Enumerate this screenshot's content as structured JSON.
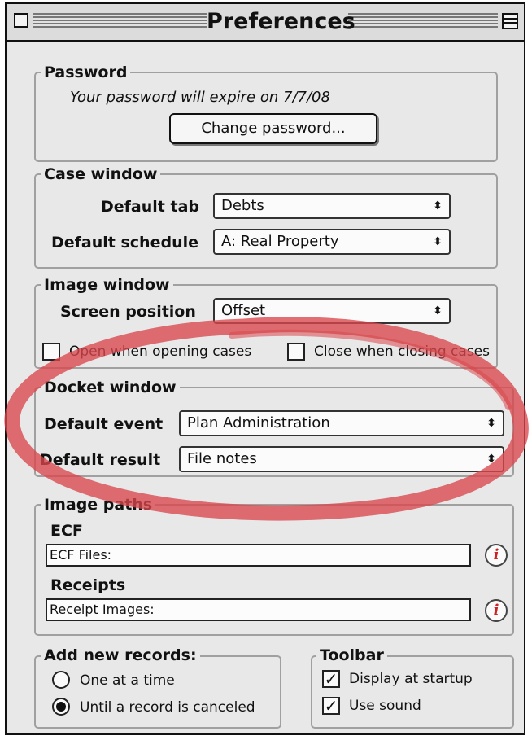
{
  "window": {
    "title": "Preferences"
  },
  "password": {
    "group_title": "Password",
    "expire_text": "Your password will expire on 7/7/08",
    "change_button": "Change password..."
  },
  "case_window": {
    "group_title": "Case window",
    "default_tab_label": "Default tab",
    "default_tab_value": "Debts",
    "default_schedule_label": "Default schedule",
    "default_schedule_value": "A: Real Property"
  },
  "image_window": {
    "group_title": "Image window",
    "screen_position_label": "Screen position",
    "screen_position_value": "Offset",
    "open_when_opening": {
      "label": "Open when opening cases",
      "checked": false
    },
    "close_when_closing": {
      "label": "Close when closing cases",
      "checked": false
    }
  },
  "docket_window": {
    "group_title": "Docket window",
    "default_event_label": "Default event",
    "default_event_value": "Plan Administration",
    "default_result_label": "Default result",
    "default_result_value": "File notes"
  },
  "image_paths": {
    "group_title": "Image paths",
    "ecf_label": "ECF",
    "ecf_value": "ECF Files:",
    "receipts_label": "Receipts",
    "receipts_value": "Receipt Images:"
  },
  "add_new_records": {
    "group_title": "Add new records:",
    "options": [
      {
        "label": "One at a time",
        "selected": false
      },
      {
        "label": "Until a record is canceled",
        "selected": true
      }
    ]
  },
  "toolbar": {
    "group_title": "Toolbar",
    "display_at_startup": {
      "label": "Display at startup",
      "checked": true
    },
    "use_sound": {
      "label": "Use sound",
      "checked": true
    }
  },
  "icons": {
    "close": "close-box-icon",
    "zoom": "window-shade-icon",
    "popup": "popup-arrows-icon",
    "info": "info-icon"
  },
  "colors": {
    "window_bg": "#e8e8e8",
    "annotation": "#d9474c",
    "info_icon": "#cc2222"
  }
}
